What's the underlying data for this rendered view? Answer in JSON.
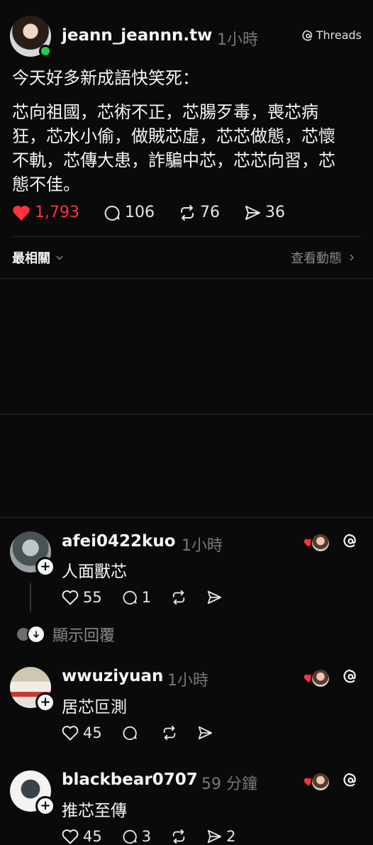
{
  "post": {
    "username": "jeann_jeannn.tw",
    "time": "1小時",
    "source_label": "Threads",
    "line1": "今天好多新成語快笑死：",
    "body": "芯向祖國，芯術不正，芯腸歹毒，喪芯病\n狂，芯水小偷，做賊芯虛，芯芯做態，芯懷\n不軌，芯傳大患，詐騙中芯，芯芯向習，芯\n態不佳。",
    "likes": "1,793",
    "comments": "106",
    "reposts": "76",
    "shares": "36"
  },
  "sort_bar": {
    "sort_label": "最相關",
    "view_activity": "查看動態"
  },
  "replies": [
    {
      "username": "afei0422kuo",
      "time": "1小時",
      "text": "人面獸芯",
      "likes": "55",
      "comments": "1",
      "reposts": "",
      "shares": ""
    },
    {
      "username": "wwuziyuan",
      "time": "1小時",
      "text": "居芯叵測",
      "likes": "45",
      "comments": "",
      "reposts": "",
      "shares": ""
    },
    {
      "username": "blackbear0707",
      "time": "59 分鐘",
      "text": "推芯至傳",
      "likes": "45",
      "comments": "3",
      "reposts": "",
      "shares": "2"
    }
  ],
  "show_replies_label": "顯示回覆",
  "colors": {
    "background": "#0a0a0a",
    "like_red": "#ff3040",
    "online_green": "#1cd14f",
    "muted": "#777777"
  }
}
